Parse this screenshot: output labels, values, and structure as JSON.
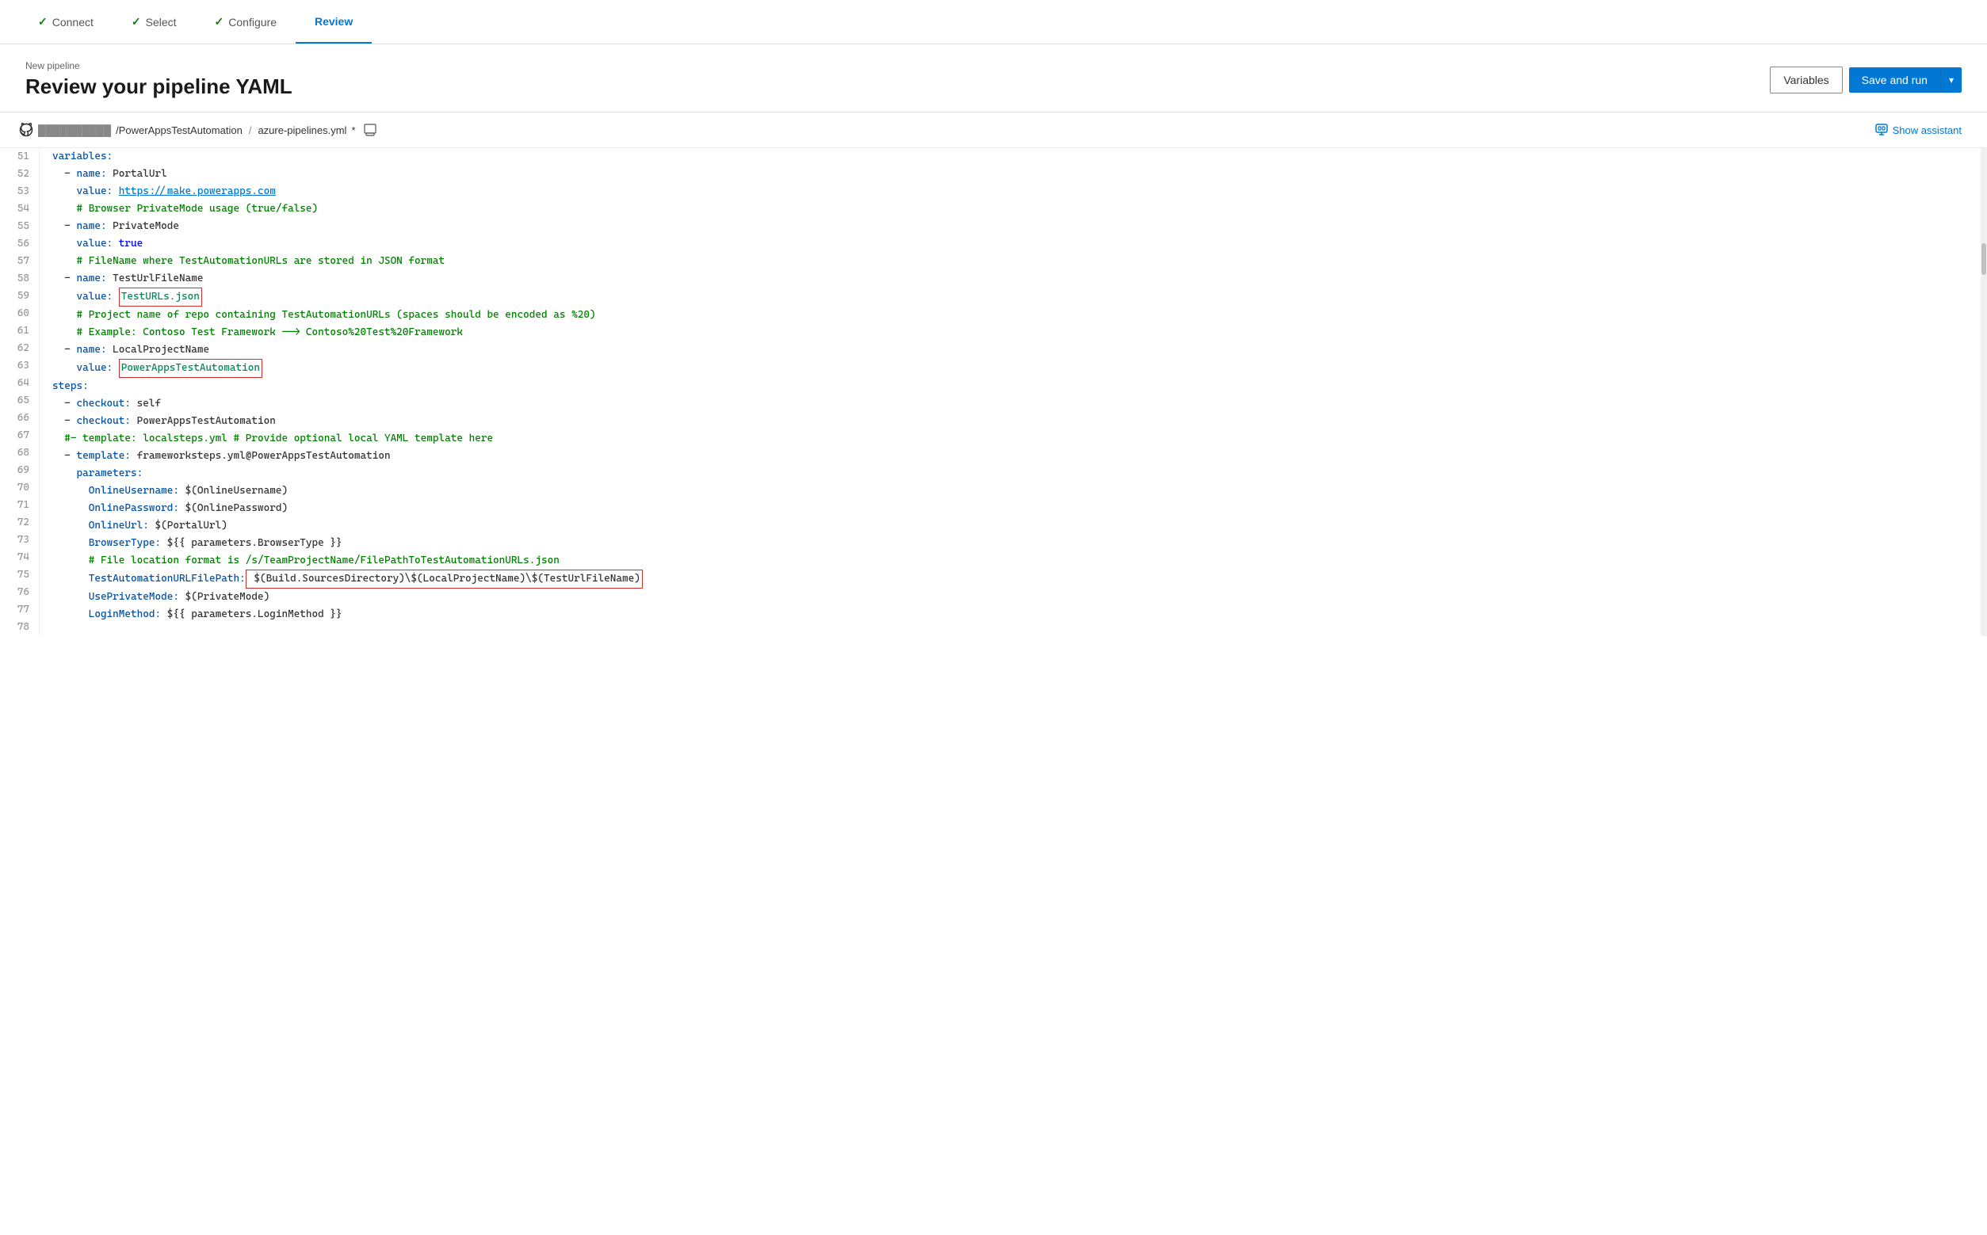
{
  "wizard": {
    "steps": [
      {
        "id": "connect",
        "label": "Connect",
        "state": "completed"
      },
      {
        "id": "select",
        "label": "Select",
        "state": "completed"
      },
      {
        "id": "configure",
        "label": "Configure",
        "state": "completed"
      },
      {
        "id": "review",
        "label": "Review",
        "state": "active"
      }
    ]
  },
  "header": {
    "breadcrumb": "New pipeline",
    "title": "Review your pipeline YAML",
    "variables_btn": "Variables",
    "save_run_btn": "Save and run"
  },
  "filebar": {
    "repo": "██████████",
    "repo_path": "/PowerAppsTestAutomation",
    "separator": "/",
    "filename": "azure-pipelines.yml",
    "modified": "*",
    "show_assistant": "Show assistant"
  },
  "code": {
    "lines": [
      {
        "num": 51,
        "tokens": [
          {
            "t": "k",
            "v": "variables:"
          }
        ]
      },
      {
        "num": 52,
        "tokens": [
          {
            "t": "dash",
            "v": "  - "
          },
          {
            "t": "k",
            "v": "name:"
          },
          {
            "t": "plain",
            "v": " PortalUrl"
          }
        ]
      },
      {
        "num": 53,
        "tokens": [
          {
            "t": "plain",
            "v": "    "
          },
          {
            "t": "k",
            "v": "value:"
          },
          {
            "t": "plain",
            "v": " "
          },
          {
            "t": "url",
            "v": "https://make.powerapps.com"
          }
        ]
      },
      {
        "num": 54,
        "tokens": [
          {
            "t": "plain",
            "v": "    "
          },
          {
            "t": "c",
            "v": "# Browser PrivateMode usage (true/false)"
          }
        ]
      },
      {
        "num": 55,
        "tokens": [
          {
            "t": "dash",
            "v": "  - "
          },
          {
            "t": "k",
            "v": "name:"
          },
          {
            "t": "plain",
            "v": " PrivateMode"
          }
        ]
      },
      {
        "num": 56,
        "tokens": [
          {
            "t": "plain",
            "v": "    "
          },
          {
            "t": "k",
            "v": "value:"
          },
          {
            "t": "plain",
            "v": " "
          },
          {
            "t": "vb",
            "v": "true"
          }
        ]
      },
      {
        "num": 57,
        "tokens": [
          {
            "t": "plain",
            "v": "    "
          },
          {
            "t": "c",
            "v": "# FileName where TestAutomationURLs are stored in JSON format"
          }
        ]
      },
      {
        "num": 58,
        "tokens": [
          {
            "t": "dash",
            "v": "  - "
          },
          {
            "t": "k",
            "v": "name:"
          },
          {
            "t": "plain",
            "v": " TestUrlFileName"
          }
        ]
      },
      {
        "num": 59,
        "tokens": [
          {
            "t": "plain",
            "v": "    "
          },
          {
            "t": "k",
            "v": "value:"
          },
          {
            "t": "plain",
            "v": " "
          },
          {
            "t": "v",
            "v": "TestURLs.json",
            "highlight": true
          }
        ]
      },
      {
        "num": 60,
        "tokens": [
          {
            "t": "plain",
            "v": "    "
          },
          {
            "t": "c",
            "v": "# Project name of repo containing TestAutomationURLs (spaces should be encoded as %20)"
          }
        ]
      },
      {
        "num": 61,
        "tokens": [
          {
            "t": "plain",
            "v": "    "
          },
          {
            "t": "c",
            "v": "# Example: Contoso Test Framework --> Contoso%20Test%20Framework"
          }
        ]
      },
      {
        "num": 62,
        "tokens": [
          {
            "t": "dash",
            "v": "  - "
          },
          {
            "t": "k",
            "v": "name:"
          },
          {
            "t": "plain",
            "v": " LocalProjectName"
          }
        ]
      },
      {
        "num": 63,
        "tokens": [
          {
            "t": "plain",
            "v": "    "
          },
          {
            "t": "k",
            "v": "value:"
          },
          {
            "t": "plain",
            "v": " "
          },
          {
            "t": "v",
            "v": "PowerAppsTestAutomation",
            "highlight": true
          }
        ]
      },
      {
        "num": 64,
        "tokens": []
      },
      {
        "num": 65,
        "tokens": [
          {
            "t": "k",
            "v": "steps:"
          }
        ]
      },
      {
        "num": 66,
        "tokens": [
          {
            "t": "dash",
            "v": "  - "
          },
          {
            "t": "k",
            "v": "checkout:"
          },
          {
            "t": "plain",
            "v": " self"
          }
        ]
      },
      {
        "num": 67,
        "tokens": [
          {
            "t": "dash",
            "v": "  - "
          },
          {
            "t": "k",
            "v": "checkout:"
          },
          {
            "t": "plain",
            "v": " PowerAppsTestAutomation"
          }
        ]
      },
      {
        "num": 68,
        "tokens": [
          {
            "t": "plain",
            "v": "  "
          },
          {
            "t": "c",
            "v": "#- template: localsteps.yml # Provide optional local YAML template here"
          }
        ]
      },
      {
        "num": 69,
        "tokens": [
          {
            "t": "dash",
            "v": "  - "
          },
          {
            "t": "k",
            "v": "template:"
          },
          {
            "t": "plain",
            "v": " frameworksteps.yml@PowerAppsTestAutomation"
          }
        ]
      },
      {
        "num": 70,
        "tokens": [
          {
            "t": "plain",
            "v": "    "
          },
          {
            "t": "k",
            "v": "parameters:"
          }
        ]
      },
      {
        "num": 71,
        "tokens": [
          {
            "t": "plain",
            "v": "      "
          },
          {
            "t": "k",
            "v": "OnlineUsername:"
          },
          {
            "t": "plain",
            "v": " $(OnlineUsername)"
          }
        ]
      },
      {
        "num": 72,
        "tokens": [
          {
            "t": "plain",
            "v": "      "
          },
          {
            "t": "k",
            "v": "OnlinePassword:"
          },
          {
            "t": "plain",
            "v": " $(OnlinePassword)"
          }
        ]
      },
      {
        "num": 73,
        "tokens": [
          {
            "t": "plain",
            "v": "      "
          },
          {
            "t": "k",
            "v": "OnlineUrl:"
          },
          {
            "t": "plain",
            "v": " $(PortalUrl)"
          }
        ]
      },
      {
        "num": 74,
        "tokens": [
          {
            "t": "plain",
            "v": "      "
          },
          {
            "t": "k",
            "v": "BrowserType:"
          },
          {
            "t": "plain",
            "v": " ${{ parameters.BrowserType }}"
          }
        ]
      },
      {
        "num": 75,
        "tokens": [
          {
            "t": "plain",
            "v": "      "
          },
          {
            "t": "c",
            "v": "# File location format is /s/TeamProjectName/FilePathToTestAutomationURLs.json"
          }
        ]
      },
      {
        "num": 76,
        "tokens": [
          {
            "t": "plain",
            "v": "      "
          },
          {
            "t": "k",
            "v": "TestAutomationURLFilePath:"
          },
          {
            "t": "plain",
            "v": " $(Build.SourcesDirectory)\\$(LocalProjectName)\\$(TestUrlFileName)",
            "highlight": true
          }
        ]
      },
      {
        "num": 77,
        "tokens": [
          {
            "t": "plain",
            "v": "      "
          },
          {
            "t": "k",
            "v": "UsePrivateMode:"
          },
          {
            "t": "plain",
            "v": " $(PrivateMode)"
          }
        ]
      },
      {
        "num": 78,
        "tokens": [
          {
            "t": "plain",
            "v": "      "
          },
          {
            "t": "k",
            "v": "LoginMethod:"
          },
          {
            "t": "plain",
            "v": " ${{ parameters.LoginMethod }}"
          }
        ]
      }
    ]
  }
}
